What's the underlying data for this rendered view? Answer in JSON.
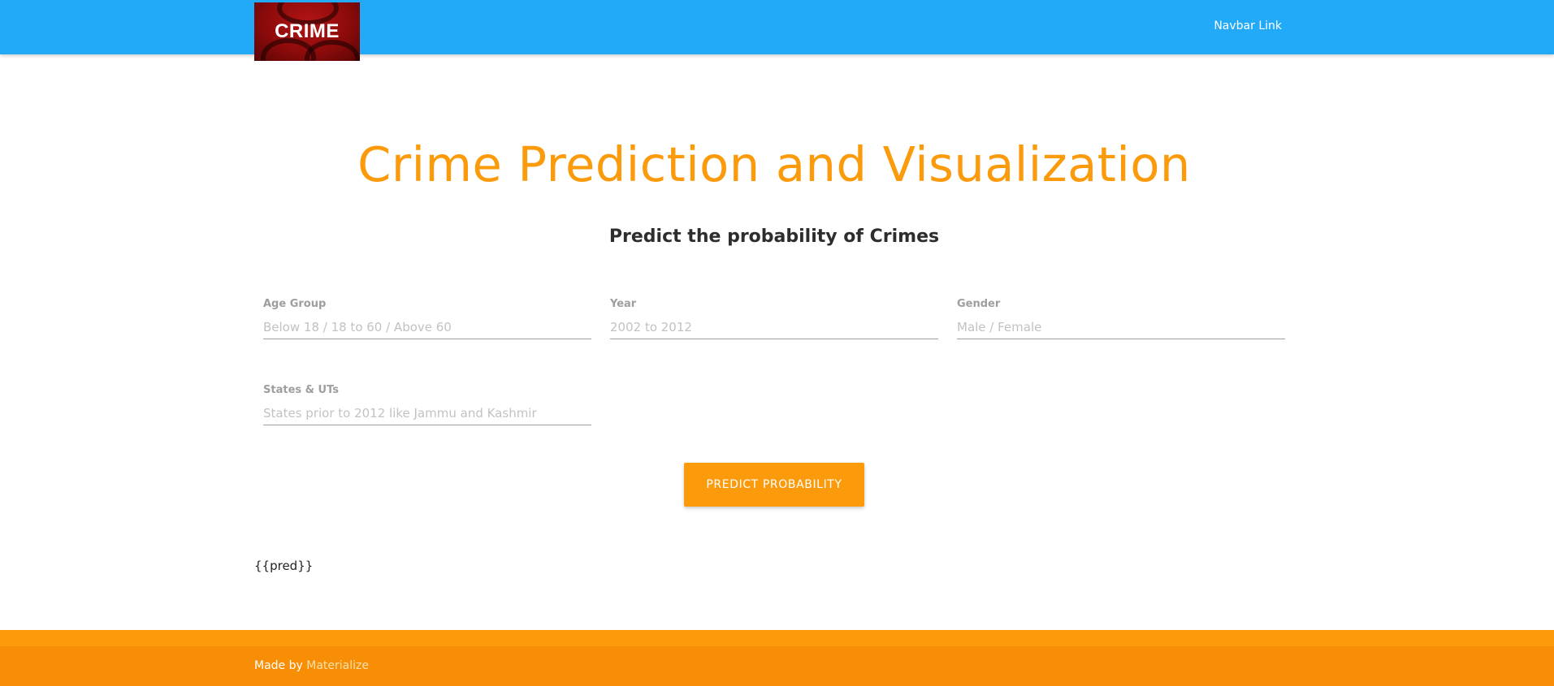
{
  "navbar": {
    "logo_text": "CRIME",
    "link_label": "Navbar Link",
    "color": "#22aaf9"
  },
  "hero": {
    "title": "Crime Prediction and Visualization",
    "subtitle": "Predict the probability of Crimes",
    "title_color": "#fb9a0b"
  },
  "form": {
    "fields": [
      {
        "label": "Age Group",
        "placeholder": "Below 18 / 18 to 60 / Above 60",
        "value": ""
      },
      {
        "label": "Year",
        "placeholder": "2002 to 2012",
        "value": ""
      },
      {
        "label": "Gender",
        "placeholder": "Male / Female",
        "value": ""
      },
      {
        "label": "States & UTs",
        "placeholder": "States prior to 2012 like Jammu and Kashmir",
        "value": ""
      }
    ],
    "submit_label": "Predict Probability",
    "accent": "#fb9a0b"
  },
  "result": {
    "text": "{{pred}}"
  },
  "footer": {
    "made_by": "Made by",
    "link_label": "Materialize",
    "color": "#f78e05"
  }
}
